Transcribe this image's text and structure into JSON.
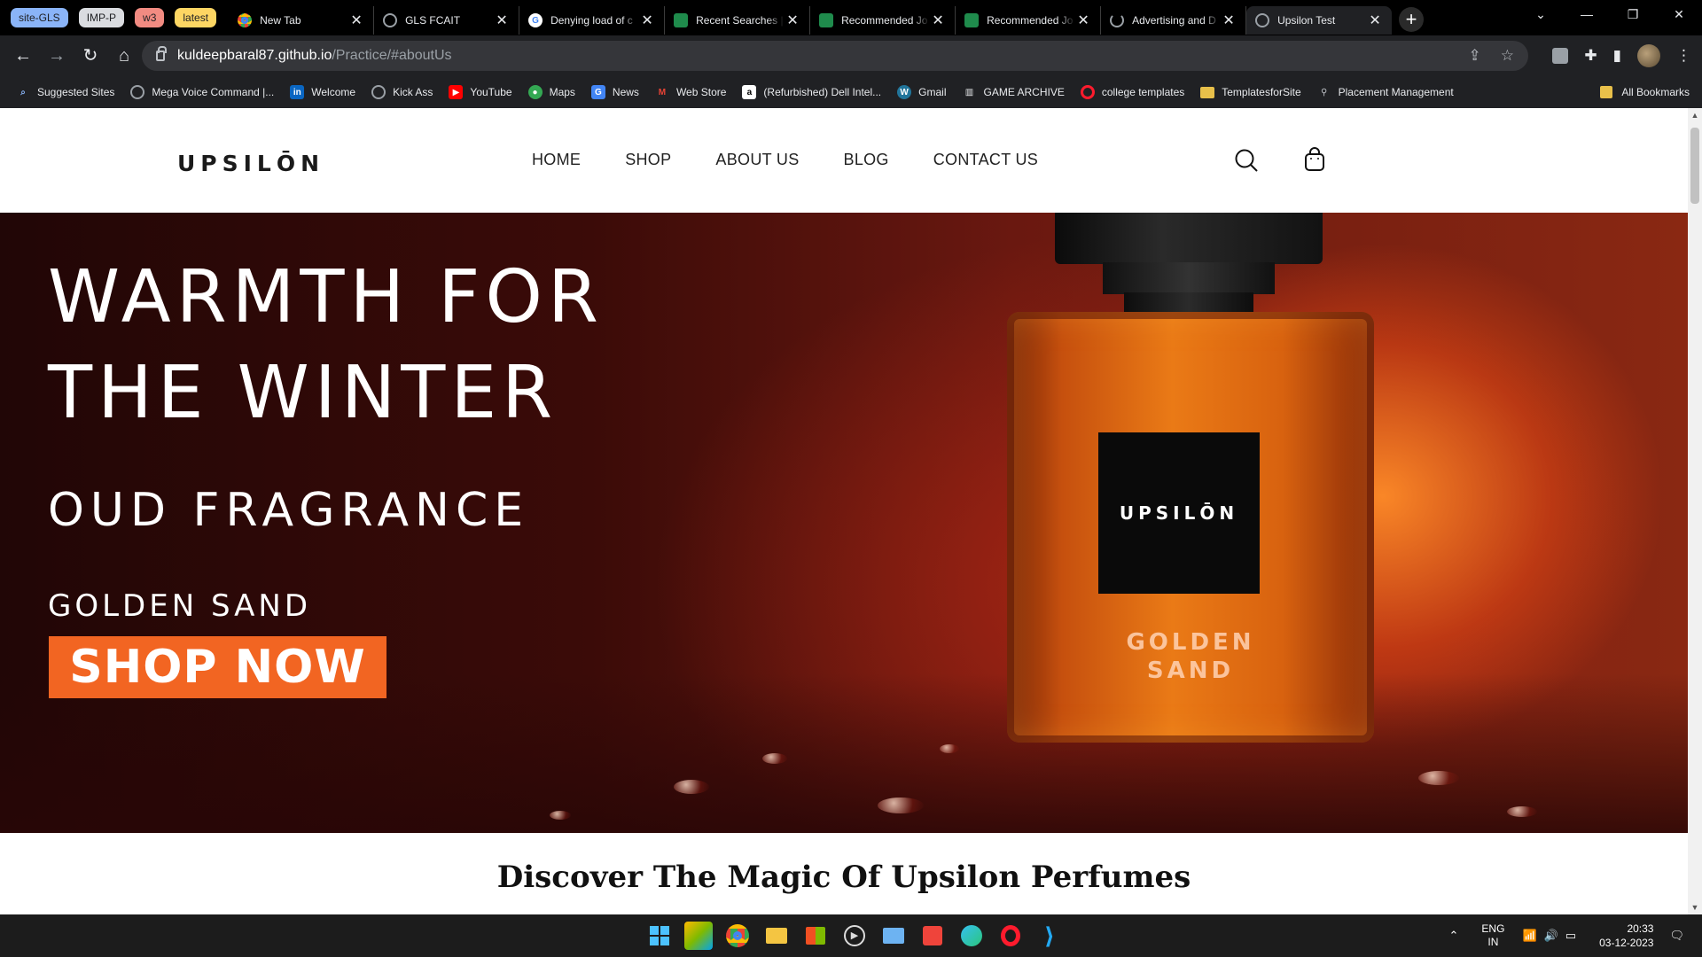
{
  "browser": {
    "tab_groups": [
      {
        "label": "site-GLS",
        "color": "#8ab4f8"
      },
      {
        "label": "IMP-P",
        "color": "#dadce0"
      },
      {
        "label": "w3",
        "color": "#f28b82"
      },
      {
        "label": "latest",
        "color": "#fdd663"
      }
    ],
    "tabs": [
      {
        "title": "New Tab",
        "icon": "chrome-icon"
      },
      {
        "title": "GLS FCAIT",
        "icon": "globe-icon"
      },
      {
        "title": "Denying load of c",
        "icon": "google-icon"
      },
      {
        "title": "Recent Searches |",
        "icon": "sheet-icon"
      },
      {
        "title": "Recommended Jo",
        "icon": "sheet-icon"
      },
      {
        "title": "Recommended Jo",
        "icon": "sheet-icon"
      },
      {
        "title": "Advertising and D",
        "icon": "loading-icon"
      },
      {
        "title": "Upsilon Test",
        "icon": "globe-icon"
      }
    ],
    "url_host": "kuldeepbaral87.github.io",
    "url_path": "/Practice/#aboutUs",
    "bookmarks": [
      {
        "label": "Suggested Sites",
        "icon": "search-icon",
        "color": "#8ab4f8"
      },
      {
        "label": "Mega Voice Command |...",
        "icon": "globe-icon",
        "color": "#9aa0a6"
      },
      {
        "label": "Welcome",
        "icon": "in-icon",
        "color": "#0a66c2"
      },
      {
        "label": "Kick Ass",
        "icon": "globe-icon",
        "color": "#9aa0a6"
      },
      {
        "label": "YouTube",
        "icon": "youtube-icon",
        "color": "#ff0000"
      },
      {
        "label": "Maps",
        "icon": "maps-icon",
        "color": "#34a853"
      },
      {
        "label": "News",
        "icon": "news-icon",
        "color": "#4285f4"
      },
      {
        "label": "Web Store",
        "icon": "gmail-icon",
        "color": "#ea4335"
      },
      {
        "label": "(Refurbished) Dell Intel...",
        "icon": "amazon-icon",
        "color": "#ffffff"
      },
      {
        "label": "Gmail",
        "icon": "wordpress-icon",
        "color": "#21759b"
      },
      {
        "label": "GAME ARCHIVE",
        "icon": "archive-icon",
        "color": "#9aa0a6"
      },
      {
        "label": "college templates",
        "icon": "opera-icon",
        "color": "#ff1b2d"
      },
      {
        "label": "TemplatesforSite",
        "icon": "folder-icon",
        "color": "#e8c04a"
      },
      {
        "label": "Placement Management",
        "icon": "pin-icon",
        "color": "#9aa0a6"
      }
    ],
    "all_bookmarks": "All Bookmarks"
  },
  "site": {
    "logo": "UPSILŌN",
    "nav": [
      "HOME",
      "SHOP",
      "ABOUT US",
      "BLOG",
      "CONTACT US"
    ],
    "hero": {
      "line1": "WARMTH FOR",
      "line2": "THE WINTER",
      "line3": "OUD FRAGRANCE",
      "line4": "GOLDEN SAND",
      "cta": "SHOP NOW",
      "bottle_label": "UPSILŌN",
      "bottle_sub1": "GOLDEN",
      "bottle_sub2": "SAND"
    },
    "section_title": "Discover The Magic Of Upsilon Perfumes",
    "accent": "#f26522"
  },
  "taskbar": {
    "lang_line1": "ENG",
    "lang_line2": "IN",
    "time": "20:33",
    "date": "03-12-2023"
  }
}
